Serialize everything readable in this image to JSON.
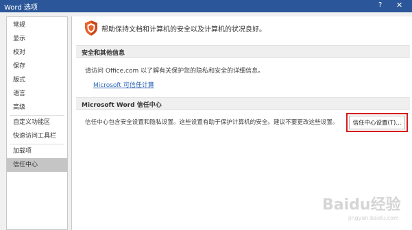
{
  "window": {
    "title": "Word 选项",
    "help_glyph": "?",
    "close_glyph": "✕"
  },
  "sidebar": {
    "items": [
      {
        "label": "常规"
      },
      {
        "label": "显示"
      },
      {
        "label": "校对"
      },
      {
        "label": "保存"
      },
      {
        "label": "版式"
      },
      {
        "label": "语言"
      },
      {
        "label": "高级"
      },
      {
        "label": "自定义功能区"
      },
      {
        "label": "快速访问工具栏"
      },
      {
        "label": "加载项"
      },
      {
        "label": "信任中心",
        "selected": true
      }
    ]
  },
  "main": {
    "intro_text": "帮助保持文档和计算机的安全以及计算机的状况良好。",
    "privacy_section": {
      "title": "安全和其他信息",
      "text": "请访问 Office.com 以了解有关保护您的隐私和安全的详细信息。",
      "link": "Microsoft 可信任计算"
    },
    "trust_center_section": {
      "title": "Microsoft Word 信任中心",
      "text": "信任中心包含安全设置和隐私设置。这些设置有助于保护计算机的安全。建议不要更改这些设置。",
      "button_label": "信任中心设置(T)..."
    }
  },
  "watermark": {
    "brand": "Baidu经验",
    "url": "jingyan.baidu.com"
  },
  "colors": {
    "titlebar": "#2b579a",
    "link": "#2c65b3",
    "highlight": "#d41c1c",
    "selected_nav": "#c5c5c5",
    "shield": "#e8622a"
  },
  "icons": {
    "shield": "shield-icon"
  }
}
